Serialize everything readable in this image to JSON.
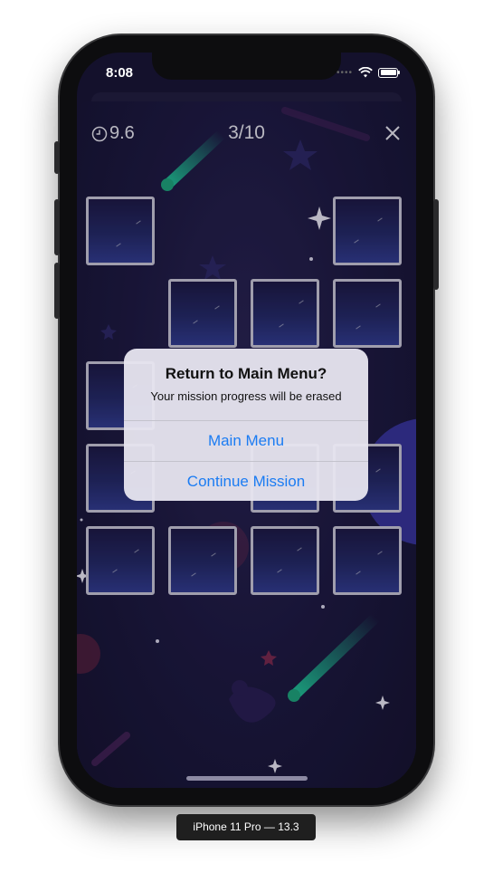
{
  "status_bar": {
    "time": "8:08"
  },
  "game": {
    "timer_value": "9.6",
    "progress": "3/10"
  },
  "alert": {
    "title": "Return to Main Menu?",
    "message": "Your mission progress will be erased",
    "buttons": [
      "Main Menu",
      "Continue Mission"
    ]
  },
  "device_caption": "iPhone 11 Pro — 13.3",
  "colors": {
    "background": "#1d1942",
    "tile_border": "#c9c6d9",
    "alert_button": "#1b7cf3",
    "comet_trail": "#21c49a"
  }
}
